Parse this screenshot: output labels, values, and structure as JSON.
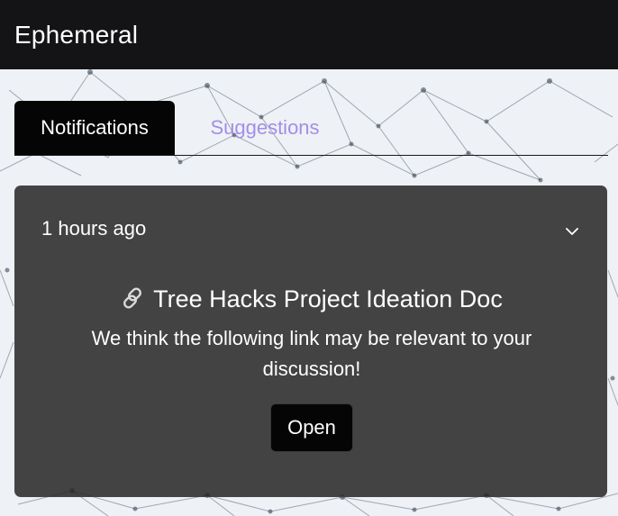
{
  "app": {
    "title": "Ephemeral"
  },
  "tabs": [
    {
      "label": "Notifications",
      "active": true
    },
    {
      "label": "Suggestions",
      "active": false
    }
  ],
  "notification": {
    "timestamp": "1 hours ago",
    "icon": "link-icon",
    "title": "Tree Hacks Project Ideation Doc",
    "message": "We think the following link may be relevant to your discussion!",
    "open_label": "Open",
    "expand_icon": "chevron-down-icon"
  },
  "colors": {
    "navbar": "#141416",
    "active_tab": "#050505",
    "inactive_tab_text": "#a38ee8",
    "card": "#262626",
    "text": "#ffffff"
  }
}
